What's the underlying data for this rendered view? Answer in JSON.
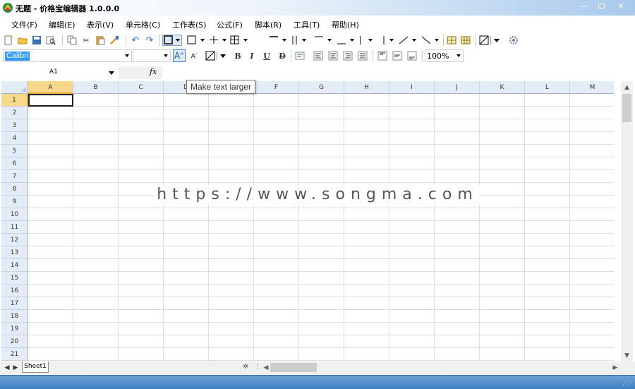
{
  "window": {
    "title": "无题 - 价格宝编辑器 1.0.0.0"
  },
  "menu": [
    "文件(F)",
    "编辑(E)",
    "表示(V)",
    "单元格(C)",
    "工作表(S)",
    "公式(F)",
    "脚本(R)",
    "工具(T)",
    "帮助(H)"
  ],
  "font_toolbar": {
    "font_name": "Calibri",
    "font_size": "",
    "zoom": "100%"
  },
  "formula_bar": {
    "cell_ref": "A1",
    "fx": "fx",
    "content": ""
  },
  "grid": {
    "columns": [
      "A",
      "B",
      "C",
      "D",
      "E",
      "F",
      "G",
      "H",
      "I",
      "J",
      "K",
      "L",
      "M"
    ],
    "rows": [
      "1",
      "2",
      "3",
      "4",
      "5",
      "6",
      "7",
      "8",
      "9",
      "10",
      "11",
      "12",
      "13",
      "14",
      "15",
      "16",
      "17",
      "18",
      "19",
      "20",
      "21"
    ],
    "selected_cell": "A1"
  },
  "sheets": [
    "Sheet1"
  ],
  "tooltip": "Make text larger",
  "watermark": "https://www.songma.com",
  "colors": {
    "header_bg": "#e4ecf7",
    "selected_header": "#f8d88a",
    "status_bar": "#4f8fcf",
    "title_gradient_end": "#a9c9ec"
  }
}
